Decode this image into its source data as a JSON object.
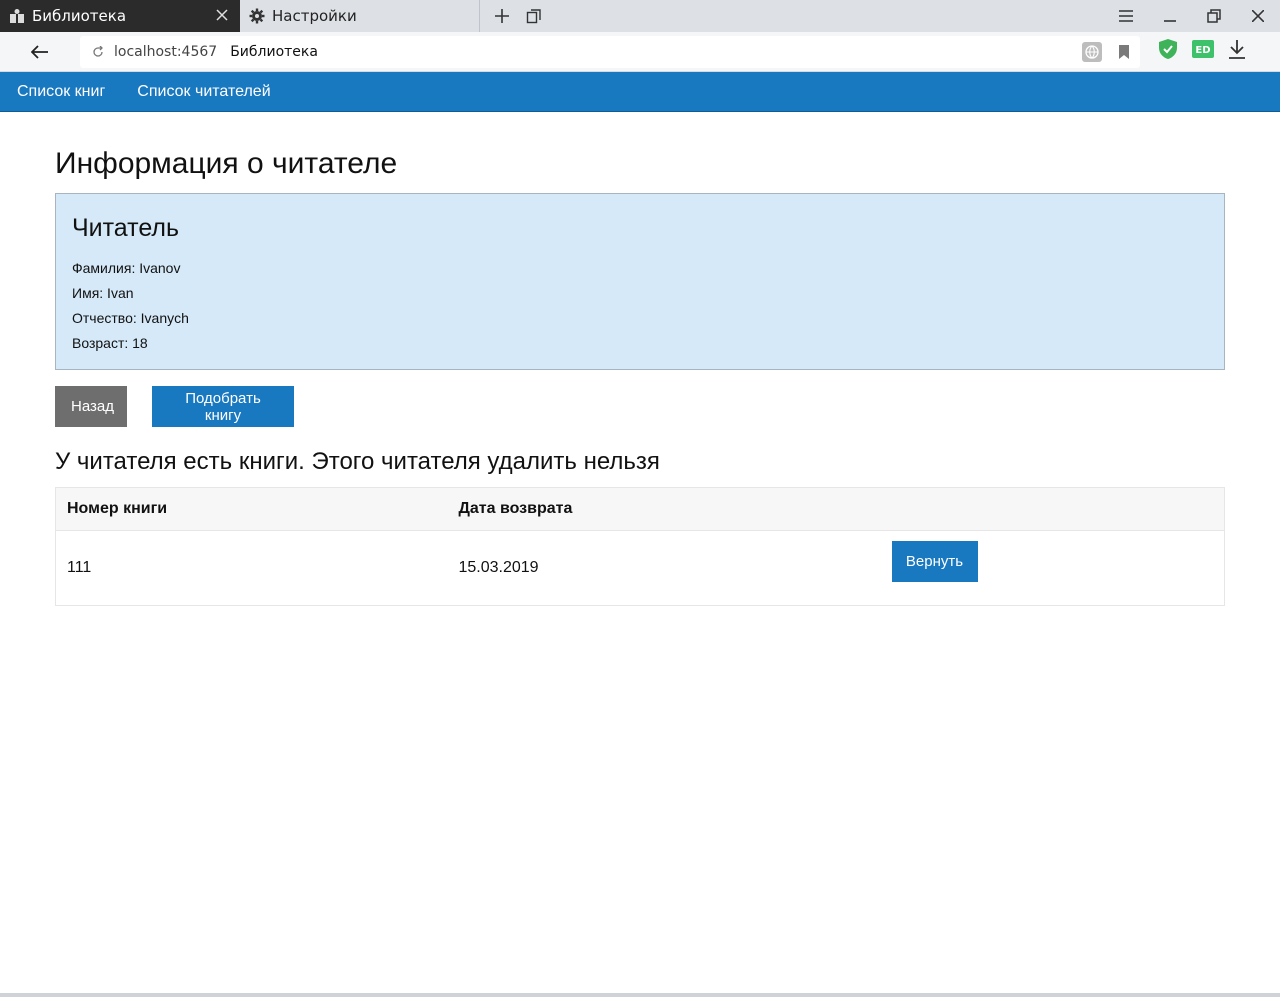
{
  "browser": {
    "tabs": [
      {
        "label": "Библиотека",
        "icon": "library-icon",
        "active": true
      },
      {
        "label": "Настройки",
        "icon": "gear-icon",
        "active": false
      }
    ],
    "url_host": "localhost:4567",
    "url_page_title": "Библиотека",
    "extensions": [
      "shield-icon",
      "ed-extension-icon"
    ]
  },
  "nav": {
    "items": [
      {
        "label": "Список книг"
      },
      {
        "label": "Список читателей"
      }
    ]
  },
  "page": {
    "title": "Информация о читателе",
    "card": {
      "title": "Читатель",
      "surname": "Фамилия: Ivanov",
      "name": "Имя: Ivan",
      "patronymic": "Отчество: Ivanych",
      "age": "Возраст: 18"
    },
    "buttons": {
      "back": "Назад",
      "pick_book": "Подобрать книгу"
    },
    "warning": "У читателя есть книги. Этого читателя удалить нельзя",
    "table": {
      "headers": [
        "Номер книги",
        "Дата возврата",
        ""
      ],
      "rows": [
        {
          "book_number": "111",
          "return_date": "15.03.2019",
          "action": "Вернуть"
        }
      ]
    }
  },
  "colors": {
    "accent": "#1878c0",
    "card_bg": "#d5e9f8",
    "grey_button": "#6e6e6e"
  }
}
